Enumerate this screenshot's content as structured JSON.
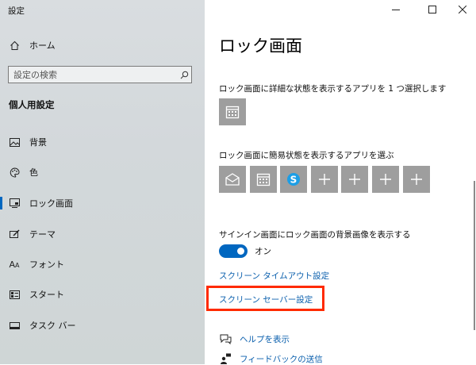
{
  "window": {
    "title": "設定"
  },
  "sidebar": {
    "home_label": "ホーム",
    "search_placeholder": "設定の検索",
    "section_title": "個人用設定",
    "items": [
      {
        "label": "背景",
        "icon": "picture-icon"
      },
      {
        "label": "色",
        "icon": "palette-icon"
      },
      {
        "label": "ロック画面",
        "icon": "lock-screen-icon",
        "active": true
      },
      {
        "label": "テーマ",
        "icon": "theme-brush-icon"
      },
      {
        "label": "フォント",
        "icon": "font-icon"
      },
      {
        "label": "スタート",
        "icon": "start-icon"
      },
      {
        "label": "タスク バー",
        "icon": "taskbar-icon"
      }
    ]
  },
  "main": {
    "title": "ロック画面",
    "detailed_status_desc": "ロック画面に詳細な状態を表示するアプリを 1 つ選択します",
    "quick_status_desc": "ロック画面に簡易状態を表示するアプリを選ぶ",
    "quick_status_tiles": [
      "mail-icon",
      "calendar-icon",
      "skype-icon",
      "plus-icon",
      "plus-icon",
      "plus-icon",
      "plus-icon"
    ],
    "signin_desc": "サインイン画面にロック画面の背景画像を表示する",
    "toggle_label": "オン",
    "toggle_on": true,
    "timeout_link": "スクリーン タイムアウト設定",
    "screensaver_link": "スクリーン セーバー設定",
    "help_link": "ヘルプを表示",
    "feedback_link": "フィードバックの送信"
  },
  "colors": {
    "accent": "#0067c0",
    "link": "#0a5fad",
    "highlight": "#ff2a00",
    "tile": "#9e9e9e"
  }
}
